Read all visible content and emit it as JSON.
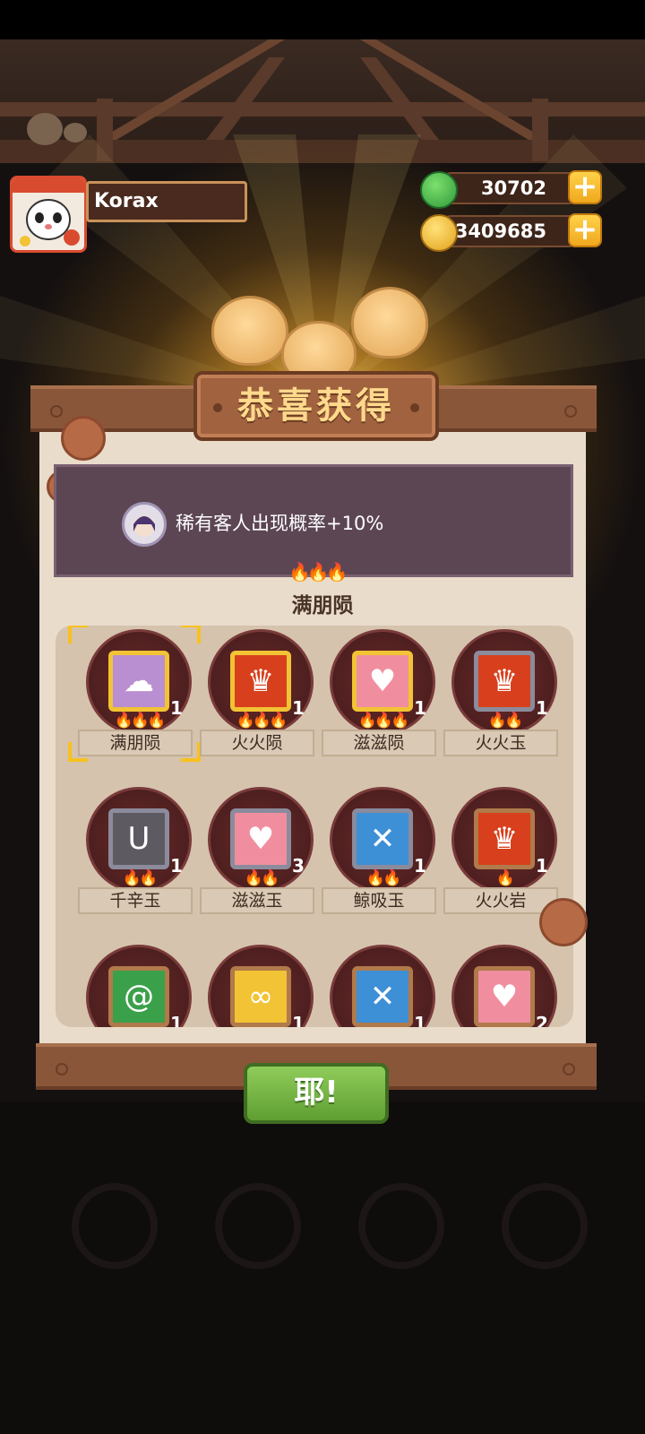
{
  "player": {
    "name": "Korax"
  },
  "currency": {
    "gems": "30702",
    "coins": "3409685",
    "plus_symbol": "+"
  },
  "dialog": {
    "title": "恭喜获得",
    "bonus_text": "稀有客人出现概率+10%",
    "subtitle": "满朋陨",
    "confirm_label": "耶!"
  },
  "items": [
    {
      "name": "满朋陨",
      "qty": "1",
      "flames": 3,
      "icon": "cloud-face-icon",
      "color": "#b98fd1",
      "frame": "#f2c334",
      "selected": true
    },
    {
      "name": "火火陨",
      "qty": "1",
      "flames": 3,
      "icon": "fire-spikes-icon",
      "color": "#d8401d",
      "frame": "#f2c334",
      "selected": false
    },
    {
      "name": "滋滋陨",
      "qty": "1",
      "flames": 3,
      "icon": "heart-icon",
      "color": "#f08ea0",
      "frame": "#f2c334",
      "selected": false
    },
    {
      "name": "火火玉",
      "qty": "1",
      "flames": 2,
      "icon": "fire-spikes-icon",
      "color": "#d8401d",
      "frame": "#8b8b9c",
      "selected": false
    },
    {
      "name": "千辛玉",
      "qty": "1",
      "flames": 2,
      "icon": "tongue-icon",
      "color": "#5d5a62",
      "frame": "#8b8b9c",
      "selected": false
    },
    {
      "name": "滋滋玉",
      "qty": "3",
      "flames": 2,
      "icon": "heart-icon",
      "color": "#f08ea0",
      "frame": "#8b8b9c",
      "selected": false
    },
    {
      "name": "鲸吸玉",
      "qty": "1",
      "flames": 2,
      "icon": "whale-icon",
      "color": "#3d8fd6",
      "frame": "#8b8b9c",
      "selected": false
    },
    {
      "name": "火火岩",
      "qty": "1",
      "flames": 1,
      "icon": "fire-spikes-icon",
      "color": "#d8401d",
      "frame": "#b07a4a",
      "selected": false
    },
    {
      "name": "",
      "qty": "1",
      "flames": 0,
      "icon": "swirl-icon",
      "color": "#3aa04a",
      "frame": "#b07a4a",
      "selected": false
    },
    {
      "name": "",
      "qty": "1",
      "flames": 0,
      "icon": "fish-icon",
      "color": "#f2c334",
      "frame": "#b07a4a",
      "selected": false
    },
    {
      "name": "",
      "qty": "1",
      "flames": 0,
      "icon": "whale-icon",
      "color": "#3d8fd6",
      "frame": "#b07a4a",
      "selected": false
    },
    {
      "name": "",
      "qty": "2",
      "flames": 0,
      "icon": "heart-icon",
      "color": "#f08ea0",
      "frame": "#b07a4a",
      "selected": false
    }
  ]
}
